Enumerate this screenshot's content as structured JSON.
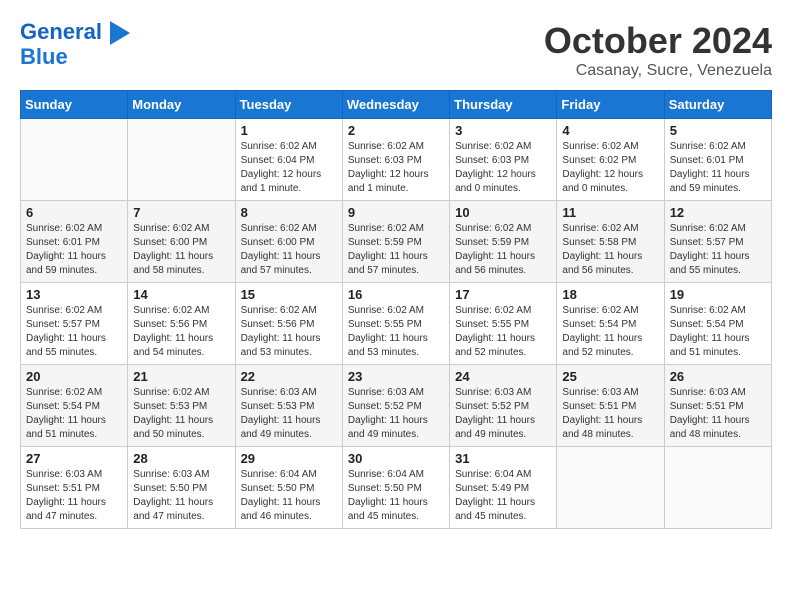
{
  "header": {
    "logo_line1": "General",
    "logo_line2": "Blue",
    "month": "October 2024",
    "location": "Casanay, Sucre, Venezuela"
  },
  "days_of_week": [
    "Sunday",
    "Monday",
    "Tuesday",
    "Wednesday",
    "Thursday",
    "Friday",
    "Saturday"
  ],
  "weeks": [
    [
      {
        "day": "",
        "empty": true
      },
      {
        "day": "",
        "empty": true
      },
      {
        "day": "1",
        "sunrise": "6:02 AM",
        "sunset": "6:04 PM",
        "daylight": "12 hours and 1 minute."
      },
      {
        "day": "2",
        "sunrise": "6:02 AM",
        "sunset": "6:03 PM",
        "daylight": "12 hours and 1 minute."
      },
      {
        "day": "3",
        "sunrise": "6:02 AM",
        "sunset": "6:03 PM",
        "daylight": "12 hours and 0 minutes."
      },
      {
        "day": "4",
        "sunrise": "6:02 AM",
        "sunset": "6:02 PM",
        "daylight": "12 hours and 0 minutes."
      },
      {
        "day": "5",
        "sunrise": "6:02 AM",
        "sunset": "6:01 PM",
        "daylight": "11 hours and 59 minutes."
      }
    ],
    [
      {
        "day": "6",
        "sunrise": "6:02 AM",
        "sunset": "6:01 PM",
        "daylight": "11 hours and 59 minutes."
      },
      {
        "day": "7",
        "sunrise": "6:02 AM",
        "sunset": "6:00 PM",
        "daylight": "11 hours and 58 minutes."
      },
      {
        "day": "8",
        "sunrise": "6:02 AM",
        "sunset": "6:00 PM",
        "daylight": "11 hours and 57 minutes."
      },
      {
        "day": "9",
        "sunrise": "6:02 AM",
        "sunset": "5:59 PM",
        "daylight": "11 hours and 57 minutes."
      },
      {
        "day": "10",
        "sunrise": "6:02 AM",
        "sunset": "5:59 PM",
        "daylight": "11 hours and 56 minutes."
      },
      {
        "day": "11",
        "sunrise": "6:02 AM",
        "sunset": "5:58 PM",
        "daylight": "11 hours and 56 minutes."
      },
      {
        "day": "12",
        "sunrise": "6:02 AM",
        "sunset": "5:57 PM",
        "daylight": "11 hours and 55 minutes."
      }
    ],
    [
      {
        "day": "13",
        "sunrise": "6:02 AM",
        "sunset": "5:57 PM",
        "daylight": "11 hours and 55 minutes."
      },
      {
        "day": "14",
        "sunrise": "6:02 AM",
        "sunset": "5:56 PM",
        "daylight": "11 hours and 54 minutes."
      },
      {
        "day": "15",
        "sunrise": "6:02 AM",
        "sunset": "5:56 PM",
        "daylight": "11 hours and 53 minutes."
      },
      {
        "day": "16",
        "sunrise": "6:02 AM",
        "sunset": "5:55 PM",
        "daylight": "11 hours and 53 minutes."
      },
      {
        "day": "17",
        "sunrise": "6:02 AM",
        "sunset": "5:55 PM",
        "daylight": "11 hours and 52 minutes."
      },
      {
        "day": "18",
        "sunrise": "6:02 AM",
        "sunset": "5:54 PM",
        "daylight": "11 hours and 52 minutes."
      },
      {
        "day": "19",
        "sunrise": "6:02 AM",
        "sunset": "5:54 PM",
        "daylight": "11 hours and 51 minutes."
      }
    ],
    [
      {
        "day": "20",
        "sunrise": "6:02 AM",
        "sunset": "5:54 PM",
        "daylight": "11 hours and 51 minutes."
      },
      {
        "day": "21",
        "sunrise": "6:02 AM",
        "sunset": "5:53 PM",
        "daylight": "11 hours and 50 minutes."
      },
      {
        "day": "22",
        "sunrise": "6:03 AM",
        "sunset": "5:53 PM",
        "daylight": "11 hours and 49 minutes."
      },
      {
        "day": "23",
        "sunrise": "6:03 AM",
        "sunset": "5:52 PM",
        "daylight": "11 hours and 49 minutes."
      },
      {
        "day": "24",
        "sunrise": "6:03 AM",
        "sunset": "5:52 PM",
        "daylight": "11 hours and 49 minutes."
      },
      {
        "day": "25",
        "sunrise": "6:03 AM",
        "sunset": "5:51 PM",
        "daylight": "11 hours and 48 minutes."
      },
      {
        "day": "26",
        "sunrise": "6:03 AM",
        "sunset": "5:51 PM",
        "daylight": "11 hours and 48 minutes."
      }
    ],
    [
      {
        "day": "27",
        "sunrise": "6:03 AM",
        "sunset": "5:51 PM",
        "daylight": "11 hours and 47 minutes."
      },
      {
        "day": "28",
        "sunrise": "6:03 AM",
        "sunset": "5:50 PM",
        "daylight": "11 hours and 47 minutes."
      },
      {
        "day": "29",
        "sunrise": "6:04 AM",
        "sunset": "5:50 PM",
        "daylight": "11 hours and 46 minutes."
      },
      {
        "day": "30",
        "sunrise": "6:04 AM",
        "sunset": "5:50 PM",
        "daylight": "11 hours and 45 minutes."
      },
      {
        "day": "31",
        "sunrise": "6:04 AM",
        "sunset": "5:49 PM",
        "daylight": "11 hours and 45 minutes."
      },
      {
        "day": "",
        "empty": true
      },
      {
        "day": "",
        "empty": true
      }
    ]
  ],
  "labels": {
    "sunrise_prefix": "Sunrise: ",
    "sunset_prefix": "Sunset: ",
    "daylight_prefix": "Daylight: "
  }
}
